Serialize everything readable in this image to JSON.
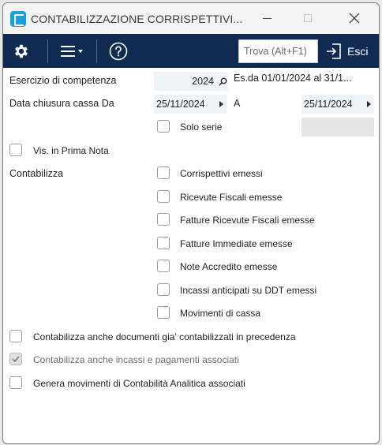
{
  "window": {
    "title": "CONTABILIZZAZIONE CORRISPETTIVI...",
    "minimize_icon": "minimize-icon",
    "maximize_icon": "maximize-icon",
    "close_icon": "close-icon"
  },
  "toolbar": {
    "settings_icon": "gear-icon",
    "menu_icon": "hamburger-menu-icon",
    "help_icon": "help-circle-icon",
    "search_placeholder": "Trova (Alt+F1)",
    "exit_label": "Esci",
    "exit_icon": "exit-door-icon",
    "background": "#0f2b52"
  },
  "form": {
    "esercizio_label": "Esercizio di competenza",
    "esercizio_value": "2024",
    "esercizio_desc": "Es.da 01/01/2024 al 31/1...",
    "data_chiusura_label": "Data chiusura cassa Da",
    "data_da_value": "25/11/2024",
    "a_label": "A",
    "data_a_value": "25/11/2024",
    "solo_serie_label": "Solo serie",
    "vis_prima_nota_label": "Vis. in Prima Nota",
    "contabilizza_label": "Contabilizza"
  },
  "contabilizza_options": [
    {
      "label": "Corrispettivi emessi",
      "checked": false
    },
    {
      "label": "Ricevute Fiscali emesse",
      "checked": false
    },
    {
      "label": "Fatture Ricevute Fiscali emesse",
      "checked": false
    },
    {
      "label": "Fatture Immediate emesse",
      "checked": false
    },
    {
      "label": "Note Accredito emesse",
      "checked": false
    },
    {
      "label": "Incassi anticipati su DDT emessi",
      "checked": false
    },
    {
      "label": "Movimenti di cassa",
      "checked": false
    }
  ],
  "bottom_options": [
    {
      "label": "Contabilizza anche documenti gia' contabilizzati in precedenza",
      "checked": false
    },
    {
      "label": "Contabilizza anche incassi e pagamenti associati",
      "checked": true,
      "disabled": true
    },
    {
      "label": "Genera movimenti di Contabilità Analitica associati",
      "checked": false
    }
  ]
}
